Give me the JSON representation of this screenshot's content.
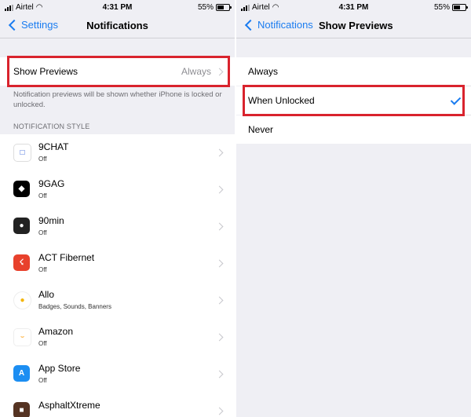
{
  "left": {
    "status": {
      "carrier": "Airtel",
      "time": "4:31 PM",
      "battery": "55%"
    },
    "nav": {
      "back_label": "Settings",
      "title": "Notifications"
    },
    "show_previews": {
      "label": "Show Previews",
      "value": "Always"
    },
    "note": "Notification previews will be shown whether iPhone is locked or unlocked.",
    "section_header": "NOTIFICATION STYLE",
    "apps": [
      {
        "name": "9CHAT",
        "status": "Off",
        "icon": "chat-bubble-icon",
        "color": "#ffffff"
      },
      {
        "name": "9GAG",
        "status": "Off",
        "icon": "9gag-icon",
        "color": "#000000"
      },
      {
        "name": "90min",
        "status": "Off",
        "icon": "soccer-ball-icon",
        "color": "#222222"
      },
      {
        "name": "ACT Fibernet",
        "status": "Off",
        "icon": "lightning-icon",
        "color": "#e8412c"
      },
      {
        "name": "Allo",
        "status": "Badges, Sounds, Banners",
        "icon": "allo-bubble-icon",
        "color": "#ffffff"
      },
      {
        "name": "Amazon",
        "status": "Off",
        "icon": "amazon-icon",
        "color": "#ffffff"
      },
      {
        "name": "App Store",
        "status": "Off",
        "icon": "app-store-icon",
        "color": "#1c8ef2"
      },
      {
        "name": "AsphaltXtreme",
        "status": "",
        "icon": "car-icon",
        "color": "#553322"
      }
    ]
  },
  "right": {
    "status": {
      "carrier": "Airtel",
      "time": "4:31 PM",
      "battery": "55%"
    },
    "nav": {
      "back_label": "Notifications",
      "title": "Show Previews"
    },
    "options": [
      {
        "label": "Always",
        "selected": false
      },
      {
        "label": "When Unlocked",
        "selected": true
      },
      {
        "label": "Never",
        "selected": false
      }
    ]
  },
  "colors": {
    "accent": "#1a7cf0",
    "highlight": "#d9232d",
    "background": "#efeff4"
  }
}
